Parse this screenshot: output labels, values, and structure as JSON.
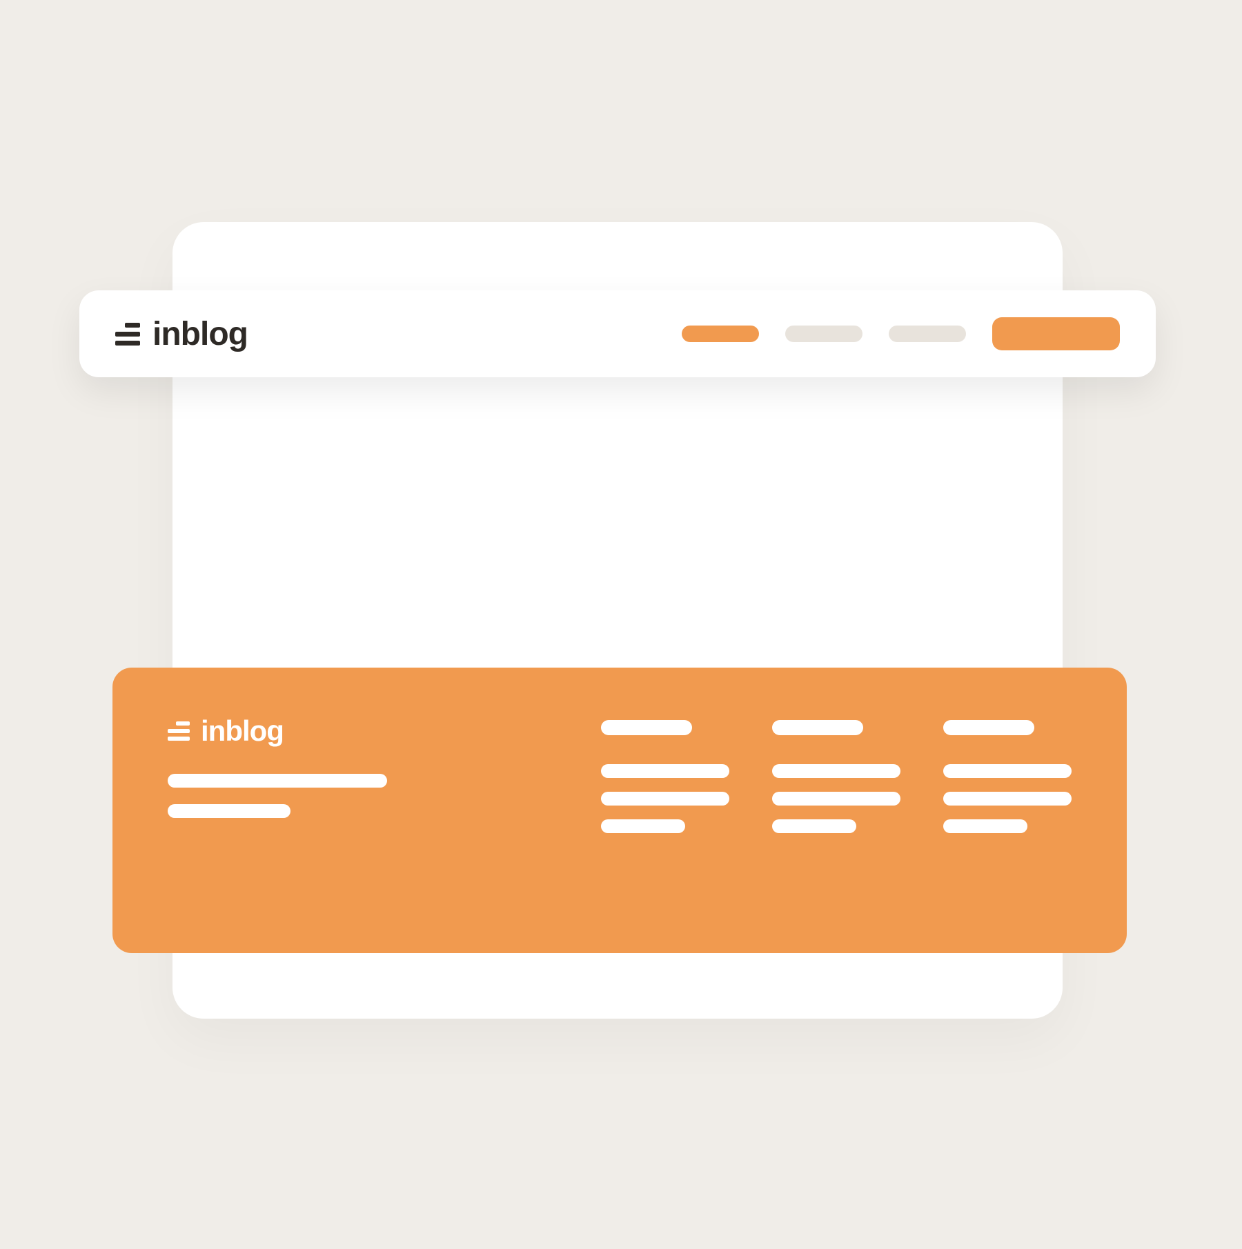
{
  "brand": {
    "name": "inblog",
    "icon": "menu-lines-icon"
  },
  "header": {
    "nav_items": [
      {
        "active": true
      },
      {
        "active": false
      },
      {
        "active": false
      }
    ],
    "cta_button": true
  },
  "footer": {
    "brand": {
      "name": "inblog",
      "icon": "menu-lines-icon"
    },
    "tagline_lines": 2,
    "columns": [
      {
        "header": true,
        "items": 3
      },
      {
        "header": true,
        "items": 3
      },
      {
        "header": true,
        "items": 3
      }
    ]
  },
  "colors": {
    "accent": "#f19a4f",
    "background": "#f0ede8",
    "card": "#ffffff",
    "text_dark": "#2e2a26",
    "placeholder": "#e8e3dc"
  }
}
